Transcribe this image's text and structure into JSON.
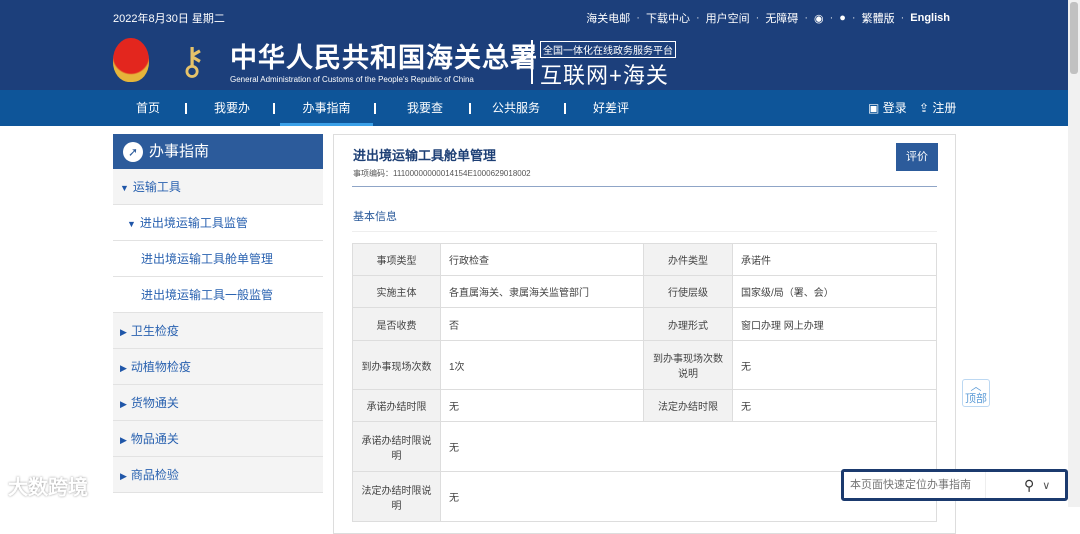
{
  "header": {
    "date": "2022年8月30日 星期二",
    "links": [
      "海关电邮",
      "下载中心",
      "用户空间",
      "无障碍",
      "繁體版",
      "English"
    ],
    "org_cn": "中华人民共和国海关总署",
    "org_en": "General Administration of Customs of the People's Republic of China",
    "platform": "全国一体化在线政务服务平台",
    "platform_name": "互联网+海关"
  },
  "nav": {
    "items": [
      "首页",
      "我要办",
      "办事指南",
      "我要查",
      "公共服务",
      "好差评"
    ],
    "active": "办事指南",
    "login": "登录",
    "register": "注册"
  },
  "sidebar": {
    "title": "办事指南",
    "items": [
      {
        "label": "运输工具",
        "level": 0,
        "expanded": true
      },
      {
        "label": "进出境运输工具监管",
        "level": 1,
        "expanded": true
      },
      {
        "label": "进出境运输工具舱单管理",
        "level": 2
      },
      {
        "label": "进出境运输工具一般监管",
        "level": 2
      },
      {
        "label": "卫生检疫",
        "level": 0
      },
      {
        "label": "动植物检疫",
        "level": 0
      },
      {
        "label": "货物通关",
        "level": 0
      },
      {
        "label": "物品通关",
        "level": 0
      },
      {
        "label": "商品检验",
        "level": 0
      }
    ]
  },
  "main": {
    "title": "进出境运输工具舱单管理",
    "code_label": "事项编码：",
    "code": "11100000000014154E1000629018002",
    "evaluate": "评价",
    "section": "基本信息",
    "rows": [
      [
        "事项类型",
        "行政检查",
        "办件类型",
        "承诺件"
      ],
      [
        "实施主体",
        "各直属海关、隶属海关监管部门",
        "行使层级",
        "国家级/局（署、会）"
      ],
      [
        "是否收费",
        "否",
        "办理形式",
        "窗口办理 网上办理"
      ],
      [
        "到办事现场次数",
        "1次",
        "到办事现场次数说明",
        "无"
      ],
      [
        "承诺办结时限",
        "无",
        "法定办结时限",
        "无"
      ],
      [
        "承诺办结时限说明",
        "无"
      ],
      [
        "法定办结时限说明",
        "无"
      ]
    ]
  },
  "to_top": "顶部",
  "search": {
    "placeholder": "本页面快速定位办事指南"
  },
  "watermark": "大数跨境"
}
